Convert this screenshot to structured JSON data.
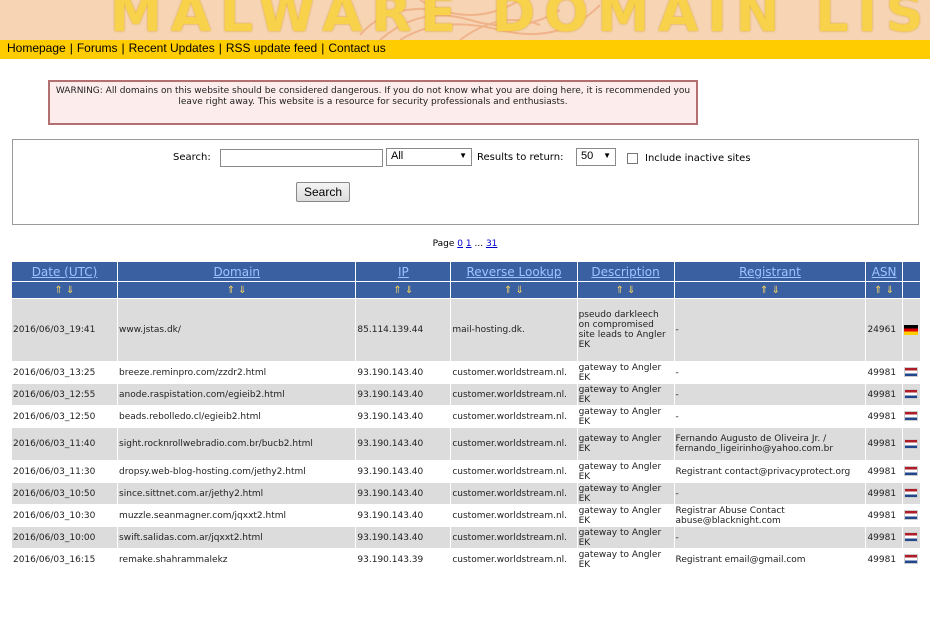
{
  "site": {
    "title": "MALWARE DOMAIN LIST"
  },
  "nav": {
    "items": [
      "Homepage",
      "Forums",
      "Recent Updates",
      "RSS update feed",
      "Contact us"
    ],
    "separator": "|"
  },
  "warning": {
    "text": "WARNING: All domains on this website should be considered dangerous. If you do not know what you are doing here, it is recommended you leave right away. This website is a resource for security professionals and enthusiasts."
  },
  "search": {
    "label": "Search:",
    "query": "",
    "scope": "All",
    "results_label": "Results to return:",
    "results_value": "50",
    "inactive_label": "Include inactive sites",
    "include_inactive": false,
    "button_label": "Search"
  },
  "pager": {
    "label": "Page",
    "pages": [
      "0",
      "1"
    ],
    "ellipsis": "...",
    "last": "31"
  },
  "table": {
    "columns": [
      "Date (UTC)",
      "Domain",
      "IP",
      "Reverse Lookup",
      "Description",
      "Registrant",
      "ASN"
    ],
    "sort_arrows": "⇑ ⇓",
    "rows": [
      {
        "date": "2016/06/03_19:41",
        "domain": "www.jstas.dk/",
        "ip": "85.114.139.44",
        "reverse": "mail-hosting.dk.",
        "description": "pseudo darkleech on compromised site leads to Angler EK",
        "registrant": "-",
        "asn": "24961",
        "flag": "de-flag-icon"
      },
      {
        "date": "2016/06/03_13:25",
        "domain": "breeze.reminpro.com/zzdr2.html",
        "ip": "93.190.143.40",
        "reverse": "customer.worldstream.nl.",
        "description": "gateway to Angler EK",
        "registrant": "-",
        "asn": "49981",
        "flag": "nl-flag-icon"
      },
      {
        "date": "2016/06/03_12:55",
        "domain": "anode.raspistation.com/egieib2.html",
        "ip": "93.190.143.40",
        "reverse": "customer.worldstream.nl.",
        "description": "gateway to Angler EK",
        "registrant": "-",
        "asn": "49981",
        "flag": "nl-flag-icon"
      },
      {
        "date": "2016/06/03_12:50",
        "domain": "beads.rebolledo.cl/egieib2.html",
        "ip": "93.190.143.40",
        "reverse": "customer.worldstream.nl.",
        "description": "gateway to Angler EK",
        "registrant": "-",
        "asn": "49981",
        "flag": "nl-flag-icon"
      },
      {
        "date": "2016/06/03_11:40",
        "domain": "sight.rocknrollwebradio.com.br/bucb2.html",
        "ip": "93.190.143.40",
        "reverse": "customer.worldstream.nl.",
        "description": "gateway to Angler EK",
        "registrant": "Fernando Augusto de Oliveira Jr. / fernando_ligeirinho@yahoo.com.br",
        "asn": "49981",
        "flag": "nl-flag-icon"
      },
      {
        "date": "2016/06/03_11:30",
        "domain": "dropsy.web-blog-hosting.com/jethy2.html",
        "ip": "93.190.143.40",
        "reverse": "customer.worldstream.nl.",
        "description": "gateway to Angler EK",
        "registrant": "Registrant contact@privacyprotect.org",
        "asn": "49981",
        "flag": "nl-flag-icon"
      },
      {
        "date": "2016/06/03_10:50",
        "domain": "since.sittnet.com.ar/jethy2.html",
        "ip": "93.190.143.40",
        "reverse": "customer.worldstream.nl.",
        "description": "gateway to Angler EK",
        "registrant": "-",
        "asn": "49981",
        "flag": "nl-flag-icon"
      },
      {
        "date": "2016/06/03_10:30",
        "domain": "muzzle.seanmagner.com/jqxxt2.html",
        "ip": "93.190.143.40",
        "reverse": "customer.worldstream.nl.",
        "description": "gateway to Angler EK",
        "registrant": "Registrar Abuse Contact abuse@blacknight.com",
        "asn": "49981",
        "flag": "nl-flag-icon"
      },
      {
        "date": "2016/06/03_10:00",
        "domain": "swift.salidas.com.ar/jqxxt2.html",
        "ip": "93.190.143.40",
        "reverse": "customer.worldstream.nl.",
        "description": "gateway to Angler EK",
        "registrant": "-",
        "asn": "49981",
        "flag": "nl-flag-icon"
      },
      {
        "date": "2016/06/03_16:15",
        "domain": "remake.shahrammalekz",
        "ip": "93.190.143.39",
        "reverse": "customer.worldstream.nl.",
        "description": "gateway to Angler EK",
        "registrant": "Registrant email@gmail.com",
        "asn": "49981",
        "flag": "nl-flag-icon"
      }
    ]
  },
  "colors": {
    "banner_bg": "#f6d4b4",
    "banner_title": "#f7d24a",
    "nav_bg": "#ffcc00",
    "table_header_bg": "#3a60a2",
    "table_header_link": "#9ec3ff",
    "row_alt_bg": "#dcdcdc",
    "warning_border": "#b47070",
    "warning_bg": "#fcecec"
  }
}
